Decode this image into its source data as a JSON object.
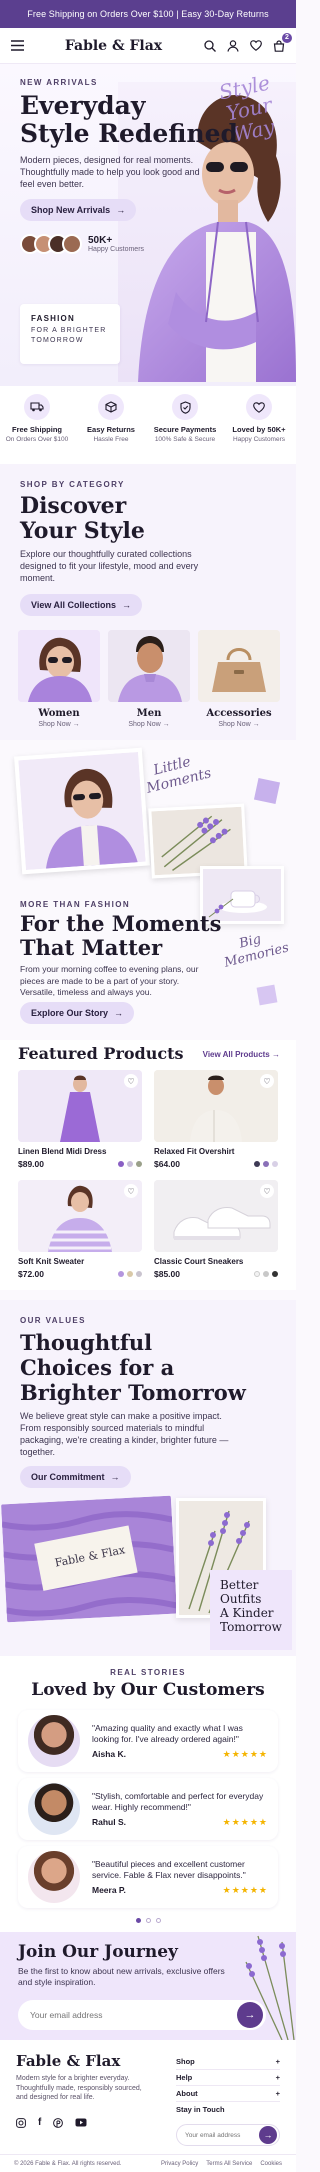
{
  "topbar": {
    "text": "Free Shipping on Orders Over $100 | Easy 30-Day Returns"
  },
  "header": {
    "brand": "Fable & Flax",
    "cart_count": "2"
  },
  "hero": {
    "eyebrow": "NEW ARRIVALS",
    "title_line1": "Everyday",
    "title_line2": "Style Redefined",
    "body": "Modern pieces, designed for real moments. Thoughtfully made to help you look good and feel even better.",
    "cta": "Shop New Arrivals",
    "happy_count": "50K+",
    "happy_label": "Happy Customers",
    "script_text": "Style Your Way",
    "card_line1": "FASHION",
    "card_line2": "FOR A BRIGHTER",
    "card_line3": "TOMORROW"
  },
  "features": [
    {
      "title": "Free Shipping",
      "sub": "On Orders Over $100"
    },
    {
      "title": "Easy Returns",
      "sub": "Hassle Free"
    },
    {
      "title": "Secure Payments",
      "sub": "100% Safe & Secure"
    },
    {
      "title": "Loved by 50K+",
      "sub": "Happy Customers"
    }
  ],
  "category": {
    "eyebrow": "SHOP BY CATEGORY",
    "title_line1": "Discover",
    "title_line2": "Your Style",
    "body": "Explore our thoughtfully curated collections designed to fit your lifestyle, mood and every moment.",
    "cta": "View All Collections",
    "items": [
      {
        "name": "Women",
        "link": "Shop Now"
      },
      {
        "name": "Men",
        "link": "Shop Now"
      },
      {
        "name": "Accessories",
        "link": "Shop Now"
      }
    ]
  },
  "moments": {
    "script1": "Little Moments",
    "script2": "Big Memories",
    "eyebrow": "MORE THAN FASHION",
    "title_line1": "For the Moments",
    "title_line2": "That Matter",
    "body": "From your morning coffee to evening plans, our pieces are made to be a part of your story. Versatile, timeless and always you.",
    "cta": "Explore Our Story"
  },
  "featured": {
    "title": "Featured Products",
    "view_all": "View All Products",
    "products": [
      {
        "name": "Linen Blend Midi Dress",
        "price": "$89.00",
        "colors": [
          "#8a5fc4",
          "#c8bfd8",
          "#9aa08a"
        ]
      },
      {
        "name": "Relaxed Fit Overshirt",
        "price": "$64.00",
        "colors": [
          "#3e3a55",
          "#8a70b8",
          "#d8d0e6"
        ]
      },
      {
        "name": "Soft Knit Sweater",
        "price": "$72.00",
        "colors": [
          "#b496de",
          "#d9c9a8",
          "#c9c4cf"
        ]
      },
      {
        "name": "Classic Court Sneakers",
        "price": "$85.00",
        "colors": [
          "#f2f2f2",
          "#c8c8c8",
          "#333333"
        ]
      }
    ]
  },
  "values": {
    "eyebrow": "OUR VALUES",
    "title_line1": "Thoughtful",
    "title_line2": "Choices for a",
    "title_line3": "Brighter Tomorrow",
    "body": "We believe great style can make a positive impact. From responsibly sourced materials to mindful packaging, we're creating a kinder, brighter future — together.",
    "cta": "Our Commitment",
    "tag_text": "Fable & Flax",
    "card_line1": "Better",
    "card_line2": "Outfits",
    "card_line3": "A Kinder",
    "card_line4": "Tomorrow"
  },
  "reviews": {
    "eyebrow": "REAL STORIES",
    "title": "Loved by Our Customers",
    "items": [
      {
        "quote": "\"Amazing quality and exactly what I was looking for. I've already ordered again!\"",
        "name": "Aisha K.",
        "stars": "★★★★★"
      },
      {
        "quote": "\"Stylish, comfortable and perfect for everyday wear. Highly recommend!\"",
        "name": "Rahul S.",
        "stars": "★★★★★"
      },
      {
        "quote": "\"Beautiful pieces and excellent customer service. Fable & Flax never disappoints.\"",
        "name": "Meera P.",
        "stars": "★★★★★"
      }
    ]
  },
  "newsletter": {
    "title": "Join Our Journey",
    "body": "Be the first to know about new arrivals, exclusive offers and style inspiration.",
    "placeholder": "Your email address"
  },
  "footer": {
    "brand": "Fable & Flax",
    "tagline": "Modern style for a brighter everyday. Thoughtfully made, responsibly sourced, and designed for real life.",
    "links": [
      "Shop",
      "Help",
      "About",
      "Stay in Touch"
    ],
    "email_placeholder": "Your email address",
    "copyright": "© 2026 Fable & Flax. All rights reserved.",
    "legal": [
      "Privacy Policy",
      "Terms All Service",
      "Cookies"
    ]
  }
}
